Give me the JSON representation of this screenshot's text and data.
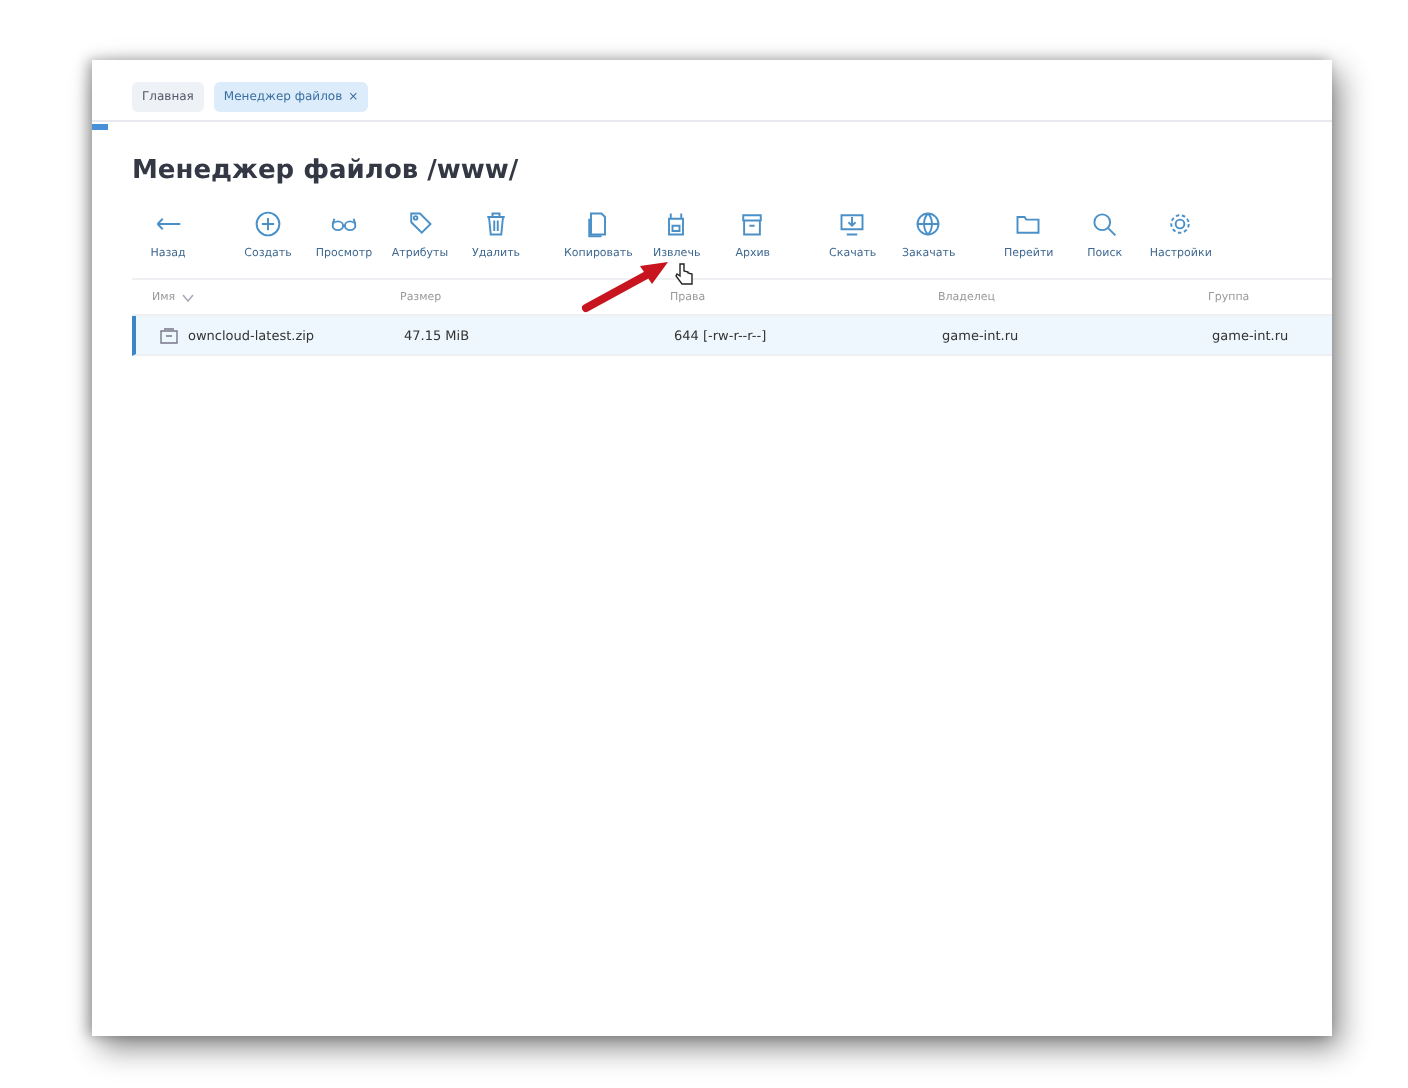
{
  "tabs": [
    {
      "label": "Главная",
      "selected": false
    },
    {
      "label": "Менеджер файлов",
      "selected": true,
      "close": "×"
    }
  ],
  "title": "Менеджер файлов /www/",
  "toolbar": [
    [
      {
        "label": "Назад"
      }
    ],
    [
      {
        "label": "Создать"
      },
      {
        "label": "Просмотр"
      },
      {
        "label": "Атрибуты"
      },
      {
        "label": "Удалить"
      }
    ],
    [
      {
        "label": "Копировать"
      },
      {
        "label": "Извлечь"
      },
      {
        "label": "Архив"
      }
    ],
    [
      {
        "label": "Скачать"
      },
      {
        "label": "Закачать"
      }
    ],
    [
      {
        "label": "Перейти"
      },
      {
        "label": "Поиск"
      },
      {
        "label": "Настройки"
      }
    ]
  ],
  "table": {
    "columns": [
      {
        "label": "Имя",
        "sorted": true
      },
      {
        "label": "Размер",
        "sorted": false
      },
      {
        "label": "Права",
        "sorted": false
      },
      {
        "label": "Владелец",
        "sorted": false
      },
      {
        "label": "Группа",
        "sorted": false
      }
    ],
    "rows": [
      {
        "selected": true,
        "cells": [
          "owncloud-latest.zip",
          "47.15 MiB",
          "644 [-rw-r--r--]",
          "game-int.ru",
          "game-int.ru"
        ]
      }
    ]
  }
}
